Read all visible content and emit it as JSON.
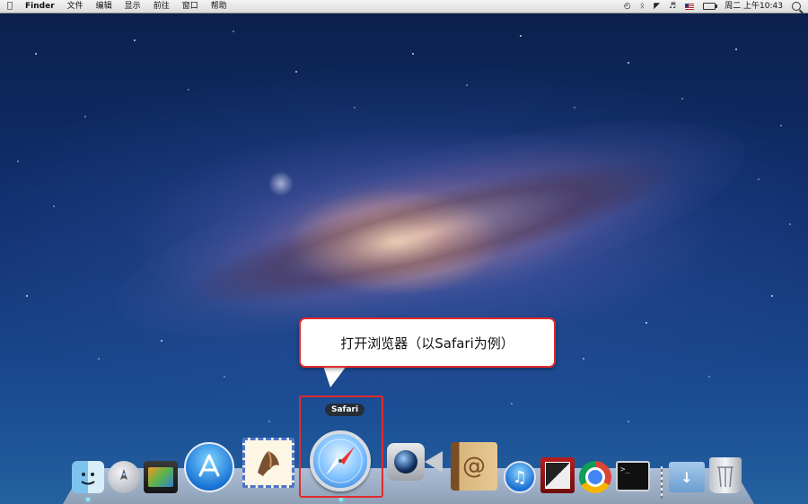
{
  "menubar": {
    "apple": "",
    "app_name": "Finder",
    "items": [
      "文件",
      "编辑",
      "显示",
      "前往",
      "窗口",
      "帮助"
    ],
    "clock": "周二 上午10:43"
  },
  "callout": {
    "text": "打开浏览器（以Safari为例）"
  },
  "dock": {
    "tooltip": "Safari",
    "icons": [
      "finder-icon",
      "launchpad-icon",
      "photo-booth-icon",
      "app-store-icon",
      "mail-icon",
      "safari-icon",
      "facetime-icon",
      "address-book-icon",
      "itunes-icon",
      "photo-icon",
      "chrome-icon",
      "terminal-icon",
      "downloads-folder-icon",
      "trash-icon"
    ]
  },
  "colors": {
    "highlight": "#e02b2b",
    "menubar": "#dcdcdc"
  }
}
